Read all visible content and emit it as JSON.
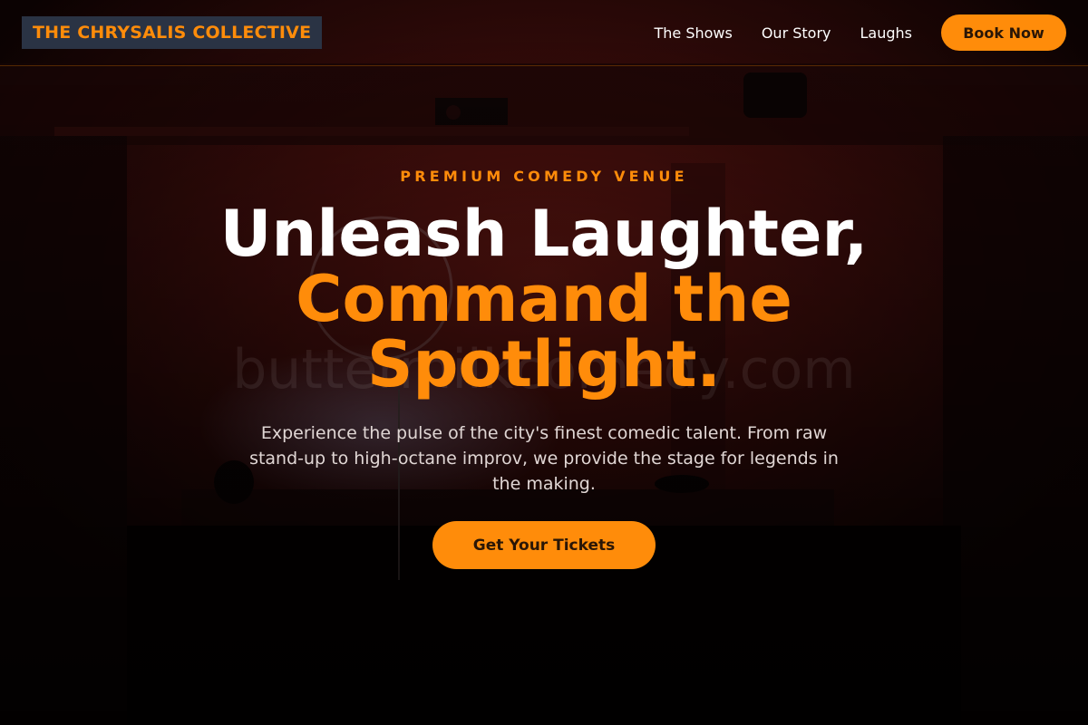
{
  "brand": {
    "name": "THE CHRYSALIS COLLECTIVE"
  },
  "nav": {
    "links": [
      "The Shows",
      "Our Story",
      "Laughs"
    ],
    "cta_label": "Book Now"
  },
  "hero": {
    "eyebrow": "PREMIUM COMEDY VENUE",
    "headline_line1": "Unleash Laughter,",
    "headline_line2": "Command the",
    "headline_line3": "Spotlight.",
    "subtext": "Experience the pulse of the city's finest comedic talent. From raw stand-up to high-octane improv, we provide the stage for legends in the making.",
    "cta_label": "Get Your Tickets"
  },
  "colors": {
    "accent": "#ff8c0a",
    "logo_bg": "#2a3344",
    "background": "#0b0303"
  }
}
